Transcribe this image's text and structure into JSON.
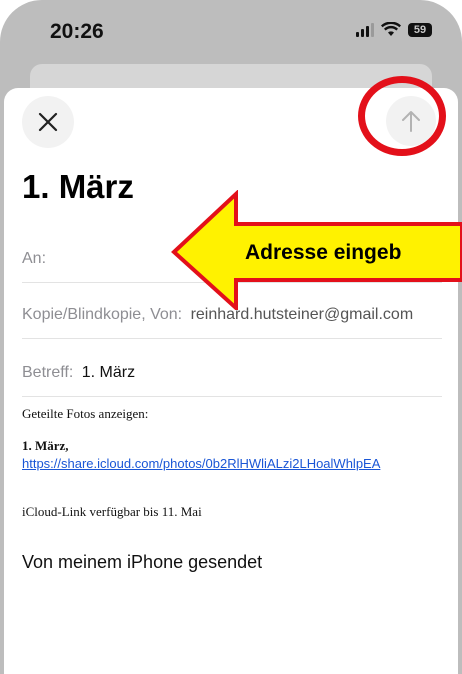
{
  "status_bar": {
    "time": "20:26",
    "battery": "59"
  },
  "compose": {
    "title": "1. März",
    "to_label": "An:",
    "cc_label": "Kopie/Blindkopie, Von:",
    "from_address": "reinhard.hutsteiner@gmail.com",
    "subject_label": "Betreff:",
    "subject_value": "1. März",
    "body": {
      "shared_photos": "Geteilte Fotos anzeigen:",
      "album_title": "1. März,",
      "link": "https://share.icloud.com/photos/0b2RlHWliALzi2LHoalWhlpEA",
      "expiry": "iCloud-Link verfügbar bis 11. Mai",
      "signature": "Von meinem iPhone gesendet"
    }
  },
  "annotation": {
    "text": "Adresse eingeb",
    "arrow_color": "#fff200",
    "arrow_outline": "#e3101a",
    "circle_color": "#e3101a"
  },
  "icons": {
    "close": "close-icon",
    "send": "arrow-up-icon"
  }
}
